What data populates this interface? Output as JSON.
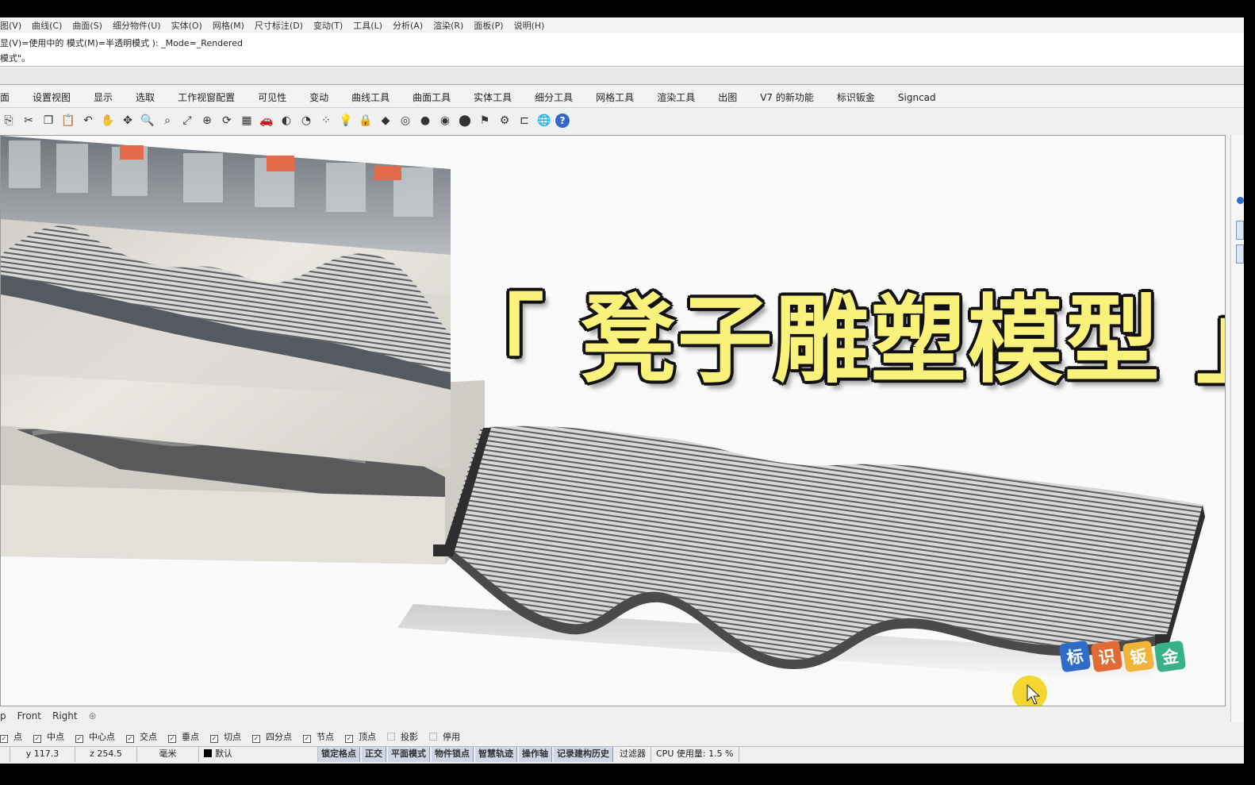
{
  "menu": [
    "图(V)",
    "曲线(C)",
    "曲面(S)",
    "细分物件(U)",
    "实体(O)",
    "网格(M)",
    "尺寸标注(D)",
    "变动(T)",
    "工具(L)",
    "分析(A)",
    "渲染(R)",
    "面板(P)",
    "说明(H)"
  ],
  "command_history": [
    "显(V)=使用中的  模式(M)=半透明模式 ): _Mode=_Rendered",
    "模式\"。"
  ],
  "tabs": [
    "面",
    "设置视图",
    "显示",
    "选取",
    "工作视窗配置",
    "可见性",
    "变动",
    "曲线工具",
    "曲面工具",
    "实体工具",
    "细分工具",
    "网格工具",
    "渲染工具",
    "出图",
    "V7 的新功能",
    "标识钣金",
    "Signcad"
  ],
  "toolbar_icons": [
    "new-icon",
    "cut-icon",
    "copy-icon",
    "paste-icon",
    "undo-icon",
    "pan-icon",
    "move-icon",
    "zoom-icon",
    "zoom-window-icon",
    "zoom-extents-icon",
    "zoom-selected-icon",
    "rotate-view-icon",
    "viewport-layout-icon",
    "car-icon",
    "display-mode-icon",
    "layer-icon",
    "point-icon",
    "light-icon",
    "lock-icon",
    "material-icon",
    "color-icon",
    "sphere-icon",
    "shaded-sphere-icon",
    "rendered-sphere-icon",
    "flag-icon",
    "gear-icon",
    "dimension-icon",
    "globe-icon",
    "help-icon"
  ],
  "headline": "「 凳子雕塑模型 」",
  "brand_logo": [
    "标",
    "识",
    "钣",
    "金"
  ],
  "brand_colors": [
    "#2f6bc9",
    "#e26a33",
    "#f2b33b",
    "#38b08a"
  ],
  "viewport_tabs": [
    "p",
    "Front",
    "Right",
    "⊕"
  ],
  "osnap": [
    {
      "label": "点",
      "checked": true
    },
    {
      "label": "中点",
      "checked": true
    },
    {
      "label": "中心点",
      "checked": true
    },
    {
      "label": "交点",
      "checked": true
    },
    {
      "label": "垂点",
      "checked": true
    },
    {
      "label": "切点",
      "checked": true
    },
    {
      "label": "四分点",
      "checked": true
    },
    {
      "label": "节点",
      "checked": true
    },
    {
      "label": "顶点",
      "checked": true
    },
    {
      "label": "投影",
      "checked": false
    },
    {
      "label": "停用",
      "checked": false
    }
  ],
  "status": {
    "y": "y 117.3",
    "z": "z 254.5",
    "unit": "毫米",
    "layer": "默认",
    "buttons": [
      "锁定格点",
      "正交",
      "平面模式",
      "物件锁点",
      "智慧轨迹",
      "操作轴",
      "记录建构历史"
    ],
    "filter": "过滤器",
    "cpu": "CPU 使用量: 1.5 %"
  }
}
